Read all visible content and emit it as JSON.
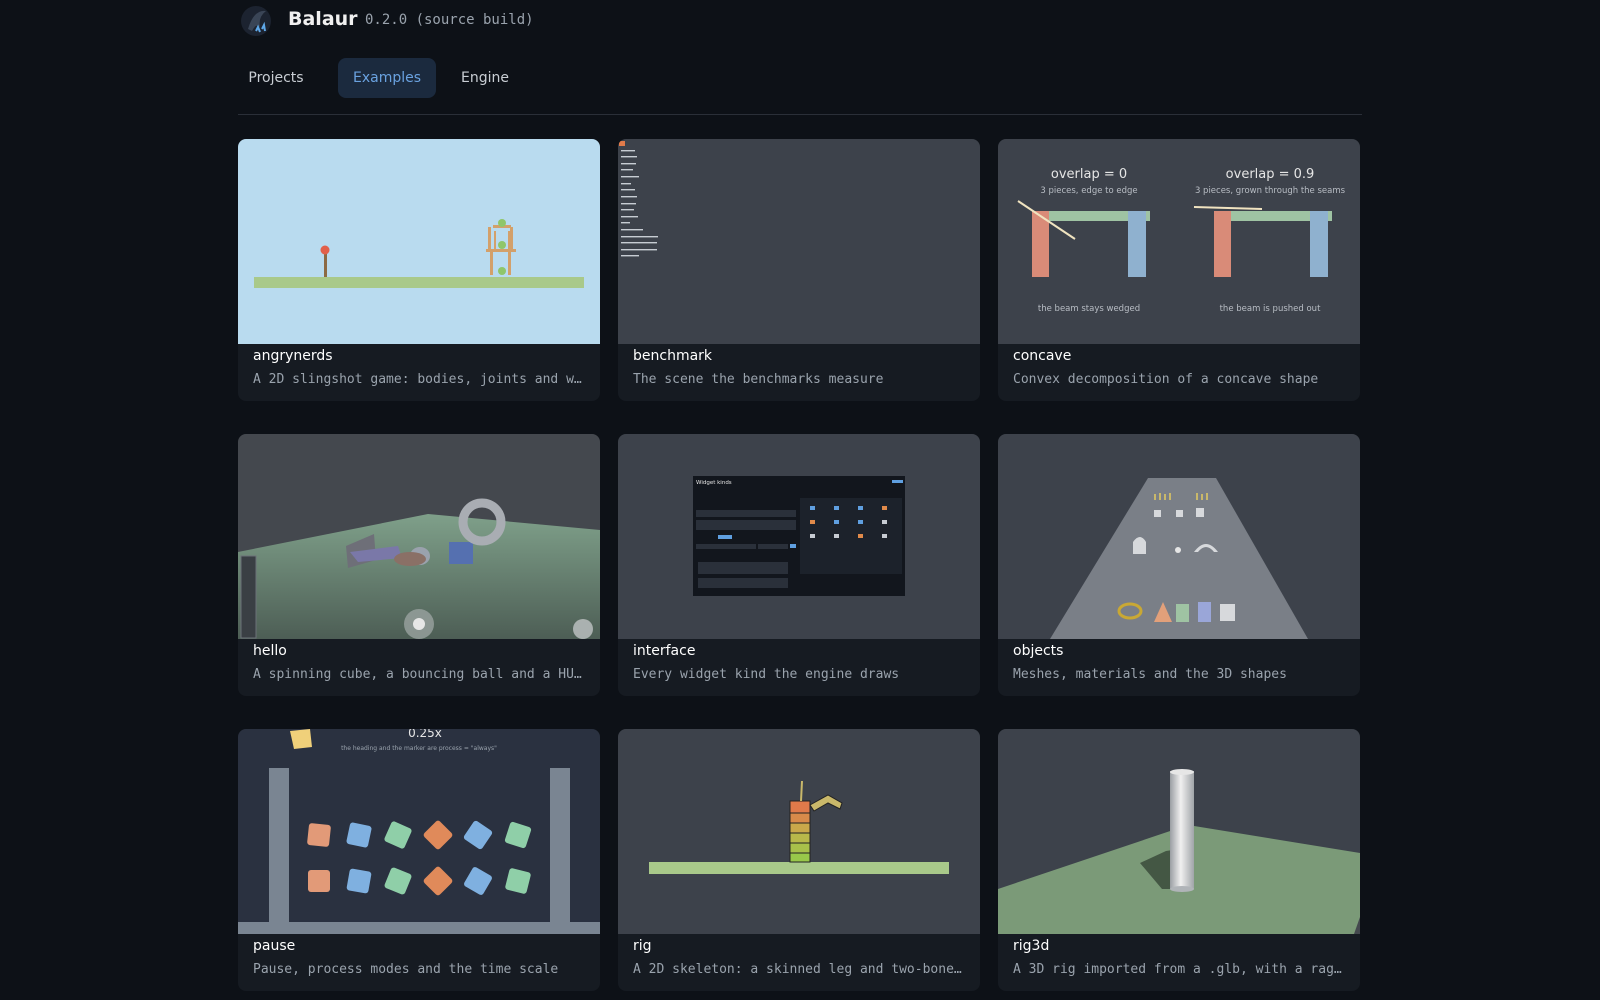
{
  "app": {
    "title": "Balaur",
    "version": "0.2.0 (source build)",
    "logo_icon": "dragon-logo-icon"
  },
  "tabs": [
    {
      "label": "Projects",
      "active": false
    },
    {
      "label": "Examples",
      "active": true
    },
    {
      "label": "Engine",
      "active": false
    }
  ],
  "examples": [
    {
      "name": "angrynerds",
      "desc": "A 2D slingshot game: bodies, joints and w…"
    },
    {
      "name": "benchmark",
      "desc": "The scene the benchmarks measure"
    },
    {
      "name": "concave",
      "desc": "Convex decomposition of a concave shape"
    },
    {
      "name": "hello",
      "desc": "A spinning cube, a bouncing ball and a HU…"
    },
    {
      "name": "interface",
      "desc": "Every widget kind the engine draws"
    },
    {
      "name": "objects",
      "desc": "Meshes, materials and the 3D shapes"
    },
    {
      "name": "pause",
      "desc": "Pause, process modes and the time scale"
    },
    {
      "name": "rig",
      "desc": "A 2D skeleton: a skinned leg and two-bone…"
    },
    {
      "name": "rig3d",
      "desc": "A 3D rig imported from a .glb, with a rag…"
    }
  ],
  "thumbs": {
    "concave": {
      "left_title": "overlap = 0",
      "left_sub": "3 pieces, edge to edge",
      "left_caption": "the beam stays wedged",
      "right_title": "overlap = 0.9",
      "right_sub": "3 pieces, grown through the seams",
      "right_caption": "the beam is pushed out"
    },
    "pause": {
      "scale": "0.25x",
      "sub": "the heading and the marker are process = \"always\""
    },
    "interface": {
      "title": "Widget kinds"
    }
  },
  "colors": {
    "background": "#0d1117",
    "card": "#161b22",
    "accent": "#6aa2e0",
    "tab_active_bg": "#1b2a3e"
  }
}
